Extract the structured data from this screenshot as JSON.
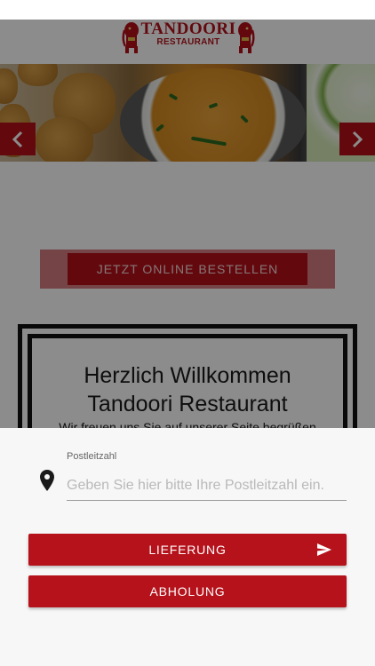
{
  "header": {
    "logo_title": "TANDOORI",
    "logo_subtitle": "RESTAURANT"
  },
  "hero": {
    "prev_icon": "chevron-left-icon",
    "next_icon": "chevron-right-icon"
  },
  "main": {
    "order_button_label": "JETZT ONLINE BESTELLEN",
    "welcome_line1": "Herzlich Willkommen",
    "welcome_line2": "Tandoori Restaurant",
    "welcome_subtitle": "Wir freuen uns Sie auf unserer Seite begrüßen"
  },
  "sheet": {
    "zip_label": "Postleitzahl",
    "zip_placeholder": "Geben Sie hier bitte Ihre Postleitzahl ein.",
    "zip_value": "",
    "location_icon": "map-pin-icon",
    "delivery_label": "LIEFERUNG",
    "delivery_icon": "send-icon",
    "pickup_label": "ABHOLUNG"
  },
  "colors": {
    "brand_red": "#b5121b",
    "sheet_background": "#f7f7f7",
    "overlay": "rgba(0,0,0,0.45)"
  }
}
